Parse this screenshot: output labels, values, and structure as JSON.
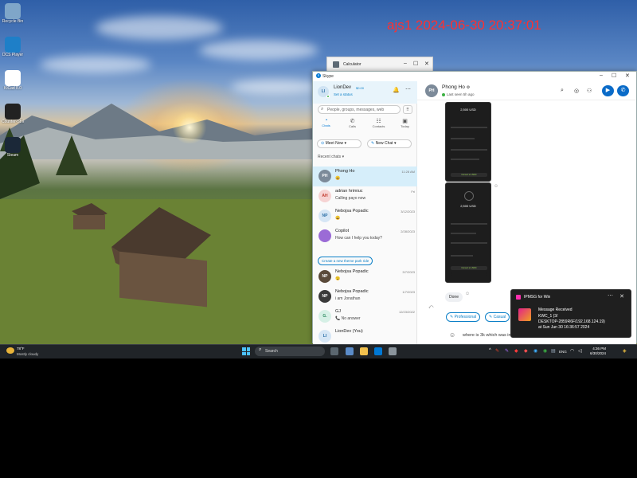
{
  "watermark": "ajs1 2024-06-30 20:37:01",
  "desktop": {
    "icons": [
      {
        "label": "Recycle Bin",
        "icon": "recycle-bin-icon",
        "color": "#7fa6c9"
      },
      {
        "label": "DCS Player",
        "icon": "media-player-icon",
        "color": "#1e7fc8"
      },
      {
        "label": "KiCad 8.0",
        "icon": "kicad-icon",
        "color": "#ffffff"
      },
      {
        "label": "Counter-Strike 2",
        "icon": "counter-strike-icon",
        "color": "#222222"
      },
      {
        "label": "Steam",
        "icon": "steam-icon",
        "color": "#1b2838"
      }
    ]
  },
  "calculator": {
    "title": "Calculator"
  },
  "skype": {
    "title": "Skype",
    "profile": {
      "initials": "LI",
      "name": "LionDev",
      "balance": "$0.00",
      "status": "Set a status"
    },
    "search_placeholder": "People, groups, messages, web",
    "nav": [
      {
        "label": "Chats",
        "icon": "chat-icon",
        "active": true
      },
      {
        "label": "Calls",
        "icon": "phone-icon",
        "active": false
      },
      {
        "label": "Contacts",
        "icon": "contacts-icon",
        "active": false
      },
      {
        "label": "Today",
        "icon": "today-icon",
        "active": false
      }
    ],
    "meet_now": "Meet Now",
    "new_chat": "New Chat",
    "recent_label": "Recent chats",
    "chats": [
      {
        "initials": "PH",
        "name": "Phong Ho",
        "preview": "😀",
        "time": "11:28 AM",
        "avatar_bg": "#7c8a99",
        "avatar_fg": "#ffffff",
        "active": true
      },
      {
        "initials": "AH",
        "name": "adrian hrimiuc",
        "preview": "Calling payo now",
        "time": "Fri",
        "avatar_bg": "#f6d3d3",
        "avatar_fg": "#c0392b",
        "active": false
      },
      {
        "initials": "NP",
        "name": "Nebojsa Popadic",
        "preview": "😀",
        "time": "3/12/2023",
        "avatar_bg": "#d6e6f5",
        "avatar_fg": "#2b6ea5",
        "active": false
      },
      {
        "initials": "",
        "name": "Copilot",
        "preview": "How can I help you today?",
        "time": "2/28/2023",
        "avatar_bg": "#9b6bd6",
        "avatar_fg": "#ffffff",
        "active": false
      }
    ],
    "chats2": [
      {
        "initials": "NP",
        "name": "Nebojsa Popadic",
        "preview": "😉",
        "time": "3/7/2023",
        "avatar_bg": "#5a4a3a",
        "avatar_fg": "#ffffff",
        "active": false
      },
      {
        "initials": "NP",
        "name": "Nebojsa Popadic",
        "preview": "i am Jonathan",
        "time": "1/7/2023",
        "avatar_bg": "#3a3a3a",
        "avatar_fg": "#ffffff",
        "active": false
      },
      {
        "initials": "G.",
        "name": "GJ",
        "preview": "📞 No answer",
        "time": "12/23/2022",
        "avatar_bg": "#d6f0e6",
        "avatar_fg": "#2c8a5f",
        "active": false
      },
      {
        "initials": "LI",
        "name": "LionDev (You)",
        "preview": "",
        "time": "",
        "avatar_bg": "#d6e6f5",
        "avatar_fg": "#2b6ea5",
        "active": false
      }
    ],
    "create_theme": "Create a new theme park ride",
    "conversation": {
      "contact": "Phong Ho",
      "last_seen": "Last seen 5h ago",
      "shot_amount": "2,500 USD",
      "shot_btn": "Convert to USDC",
      "done_msg": "Done",
      "suggestions": [
        "Professional",
        "Casual"
      ],
      "compose_text": "where is 3k which was in"
    }
  },
  "notification": {
    "app": "IPMSG for Win",
    "title": "Message Received",
    "line1": "KWC_1 (3/",
    "line2": "DESKTOP-2859R6F/192.168.124.19)",
    "line3": "at Sun Jun 30 16:36:57 2024"
  },
  "taskbar": {
    "temp": "78°F",
    "condition": "Mostly cloudy",
    "search_placeholder": "Search",
    "lang": "ENG",
    "time": "4:36 PM",
    "date": "6/30/2024"
  }
}
